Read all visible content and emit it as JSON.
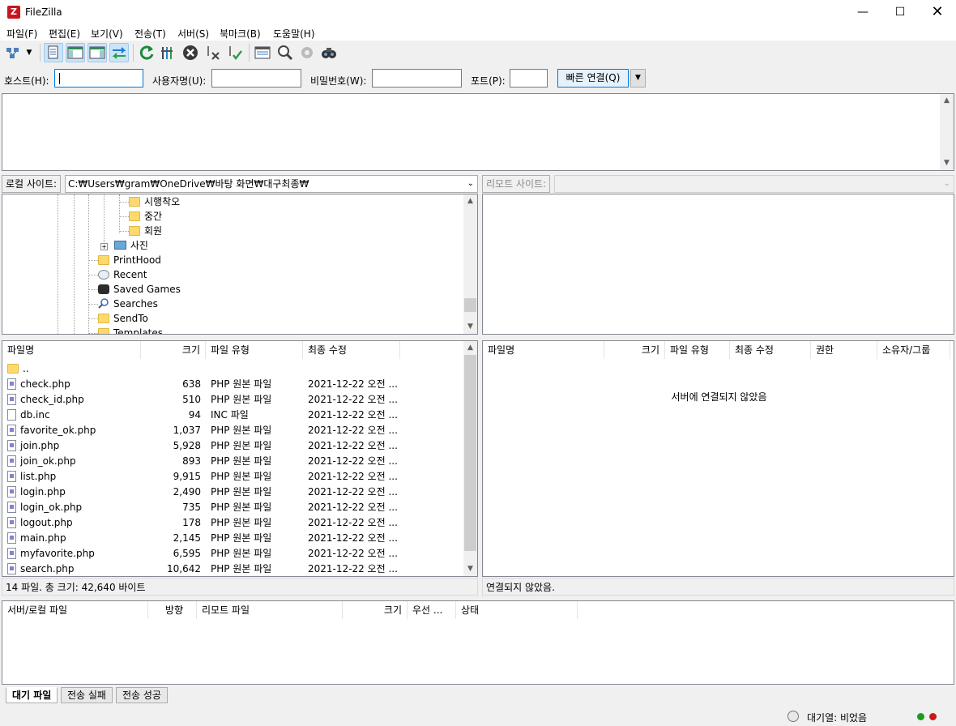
{
  "window": {
    "title": "FileZilla",
    "icon_letter": "Z"
  },
  "menu": [
    "파일(F)",
    "편집(E)",
    "보기(V)",
    "전송(T)",
    "서버(S)",
    "북마크(B)",
    "도움말(H)"
  ],
  "quickconnect": {
    "host_label": "호스트(H):",
    "host_value": "",
    "user_label": "사용자명(U):",
    "user_value": "",
    "pass_label": "비밀번호(W):",
    "pass_value": "",
    "port_label": "포트(P):",
    "port_value": "",
    "button_label": "빠른 연결(Q)"
  },
  "local_site": {
    "label": "로컬 사이트:",
    "path": "C:₩Users₩gram₩OneDrive₩바탕 화면₩대구최종₩"
  },
  "remote_site": {
    "label": "리모트 사이트:",
    "path": ""
  },
  "local_tree": [
    {
      "name": "시행착오",
      "type": "folder"
    },
    {
      "name": "중간",
      "type": "folder"
    },
    {
      "name": "회원",
      "type": "folder"
    },
    {
      "name": "사진",
      "type": "pictures",
      "expander": "+"
    },
    {
      "name": "PrintHood",
      "type": "folder"
    },
    {
      "name": "Recent",
      "type": "recent"
    },
    {
      "name": "Saved Games",
      "type": "games"
    },
    {
      "name": "Searches",
      "type": "search"
    },
    {
      "name": "SendTo",
      "type": "folder"
    },
    {
      "name": "Templates",
      "type": "folder"
    }
  ],
  "local_columns": [
    "파일명",
    "크기",
    "파일 유형",
    "최종 수정"
  ],
  "local_files": [
    {
      "name": "..",
      "size": "",
      "type": "",
      "modified": "",
      "kind": "folder"
    },
    {
      "name": "check.php",
      "size": "638",
      "type": "PHP 원본 파일",
      "modified": "2021-12-22 오전 ...",
      "kind": "php"
    },
    {
      "name": "check_id.php",
      "size": "510",
      "type": "PHP 원본 파일",
      "modified": "2021-12-22 오전 ...",
      "kind": "php"
    },
    {
      "name": "db.inc",
      "size": "94",
      "type": "INC 파일",
      "modified": "2021-12-22 오전 ...",
      "kind": "file"
    },
    {
      "name": "favorite_ok.php",
      "size": "1,037",
      "type": "PHP 원본 파일",
      "modified": "2021-12-22 오전 ...",
      "kind": "php"
    },
    {
      "name": "join.php",
      "size": "5,928",
      "type": "PHP 원본 파일",
      "modified": "2021-12-22 오전 ...",
      "kind": "php"
    },
    {
      "name": "join_ok.php",
      "size": "893",
      "type": "PHP 원본 파일",
      "modified": "2021-12-22 오전 ...",
      "kind": "php"
    },
    {
      "name": "list.php",
      "size": "9,915",
      "type": "PHP 원본 파일",
      "modified": "2021-12-22 오전 ...",
      "kind": "php"
    },
    {
      "name": "login.php",
      "size": "2,490",
      "type": "PHP 원본 파일",
      "modified": "2021-12-22 오전 ...",
      "kind": "php"
    },
    {
      "name": "login_ok.php",
      "size": "735",
      "type": "PHP 원본 파일",
      "modified": "2021-12-22 오전 ...",
      "kind": "php"
    },
    {
      "name": "logout.php",
      "size": "178",
      "type": "PHP 원본 파일",
      "modified": "2021-12-22 오전 ...",
      "kind": "php"
    },
    {
      "name": "main.php",
      "size": "2,145",
      "type": "PHP 원본 파일",
      "modified": "2021-12-22 오전 ...",
      "kind": "php"
    },
    {
      "name": "myfavorite.php",
      "size": "6,595",
      "type": "PHP 원본 파일",
      "modified": "2021-12-22 오전 ...",
      "kind": "php"
    },
    {
      "name": "search.php",
      "size": "10,642",
      "type": "PHP 원본 파일",
      "modified": "2021-12-22 오전 ...",
      "kind": "php"
    }
  ],
  "local_status": "14 파일. 총 크기: 42,640 바이트",
  "remote_columns": [
    "파일명",
    "크기",
    "파일 유형",
    "최종 수정",
    "권한",
    "소유자/그룹"
  ],
  "remote_message": "서버에 연결되지 않았음",
  "remote_status": "연결되지 않았음.",
  "queue_columns": [
    "서버/로컬 파일",
    "방향",
    "리모트 파일",
    "크기",
    "우선 ...",
    "상태"
  ],
  "queue_tabs": [
    "대기 파일",
    "전송 실패",
    "전송 성공"
  ],
  "status": {
    "queue_text": "대기열: 비었음"
  },
  "colors": {
    "accent": "#0078d7",
    "green_led": "#1c9a1c",
    "red_led": "#c81a1a"
  }
}
